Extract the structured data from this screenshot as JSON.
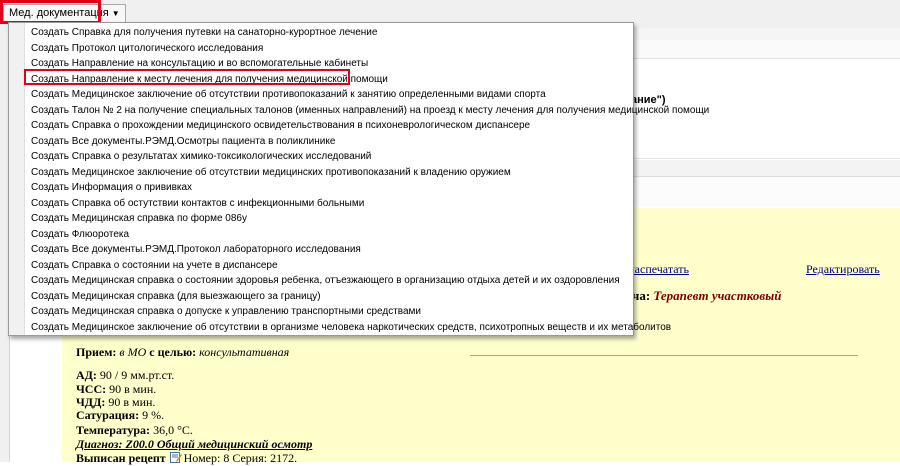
{
  "toolbar": {
    "med_docs_label": "Мед. документация"
  },
  "background": {
    "fragment": "ание\")"
  },
  "menu": {
    "items": [
      "Создать Справка для получения путевки на санаторно-курортное лечение",
      "Создать Протокол цитологического исследования",
      "Создать Направление на консультацию и во вспомогательные кабинеты",
      "Создать Направление к месту лечения для получения медицинской помощи",
      "Создать Медицинское заключение об отсутствии противопоказаний к занятию определенными видами спорта",
      "Создать Талон № 2 на получение специальных талонов (именных направлений) на проезд к месту лечения для получения медицинской помощи",
      "Создать Справка о прохождении медицинского освидетельствования в психоневрологическом диспансере",
      "Создать Все документы.РЭМД.Осмотры пациента в поликлинике",
      "Создать Справка о результатах химико-токсикологических исследований",
      "Создать Медицинское заключение об отсутствии медицинских противопоказаний к владению оружием",
      "Создать Информация о прививках",
      "Создать Справка об остутствии контактов с инфекционными больными",
      "Создать Медицинская справка по форме 086у",
      "Создать Флюоротека",
      "Создать Все документы.РЭМД.Протокол лабораторного исследования",
      "Создать Справка о состоянии на учете в диспансере",
      "Создать Медицинская справка о состоянии здоровья ребенка, отъезжающего в организацию отдыха детей и их оздоровления",
      "Создать Медицинская справка (для выезжающего за границу)",
      "Создать Медицинская справка о допуске к управлению транспортными средствами",
      "Создать Медицинское заключение об отсутствии в организме человека наркотических средств, психотропных веществ и их метаболитов"
    ],
    "highlighted_index": 3
  },
  "record": {
    "print_link": "Распечатать",
    "edit_link": "Редактировать",
    "specialist_suffix": "ча: ",
    "specialist_value": "Терапевт участковый",
    "reception_label": "Прием:",
    "reception_place": "в МО",
    "reception_goal_label": "с целью:",
    "reception_goal": "консультативная",
    "bp_label": "АД:",
    "bp_value": "90 / 9 мм.рт.ст.",
    "hr_label": "ЧСС:",
    "hr_value": "90 в мин.",
    "rr_label": "ЧДД:",
    "rr_value": "90 в мин.",
    "spo2_label": "Сатурация:",
    "spo2_value": "9 %.",
    "temp_label": "Температура:",
    "temp_value": "36,0 °C.",
    "diag_label": "Диагноз:",
    "diag_value": "Z00.0 Общий медицинский осмотр",
    "rx_label": "Выписан рецепт",
    "rx_value": "Номер: 8 Серия: 2172."
  },
  "colors": {
    "highlight_red": "#e0001c",
    "record_bg": "#ffffcc",
    "link": "#00008b",
    "specialist": "#800000"
  }
}
